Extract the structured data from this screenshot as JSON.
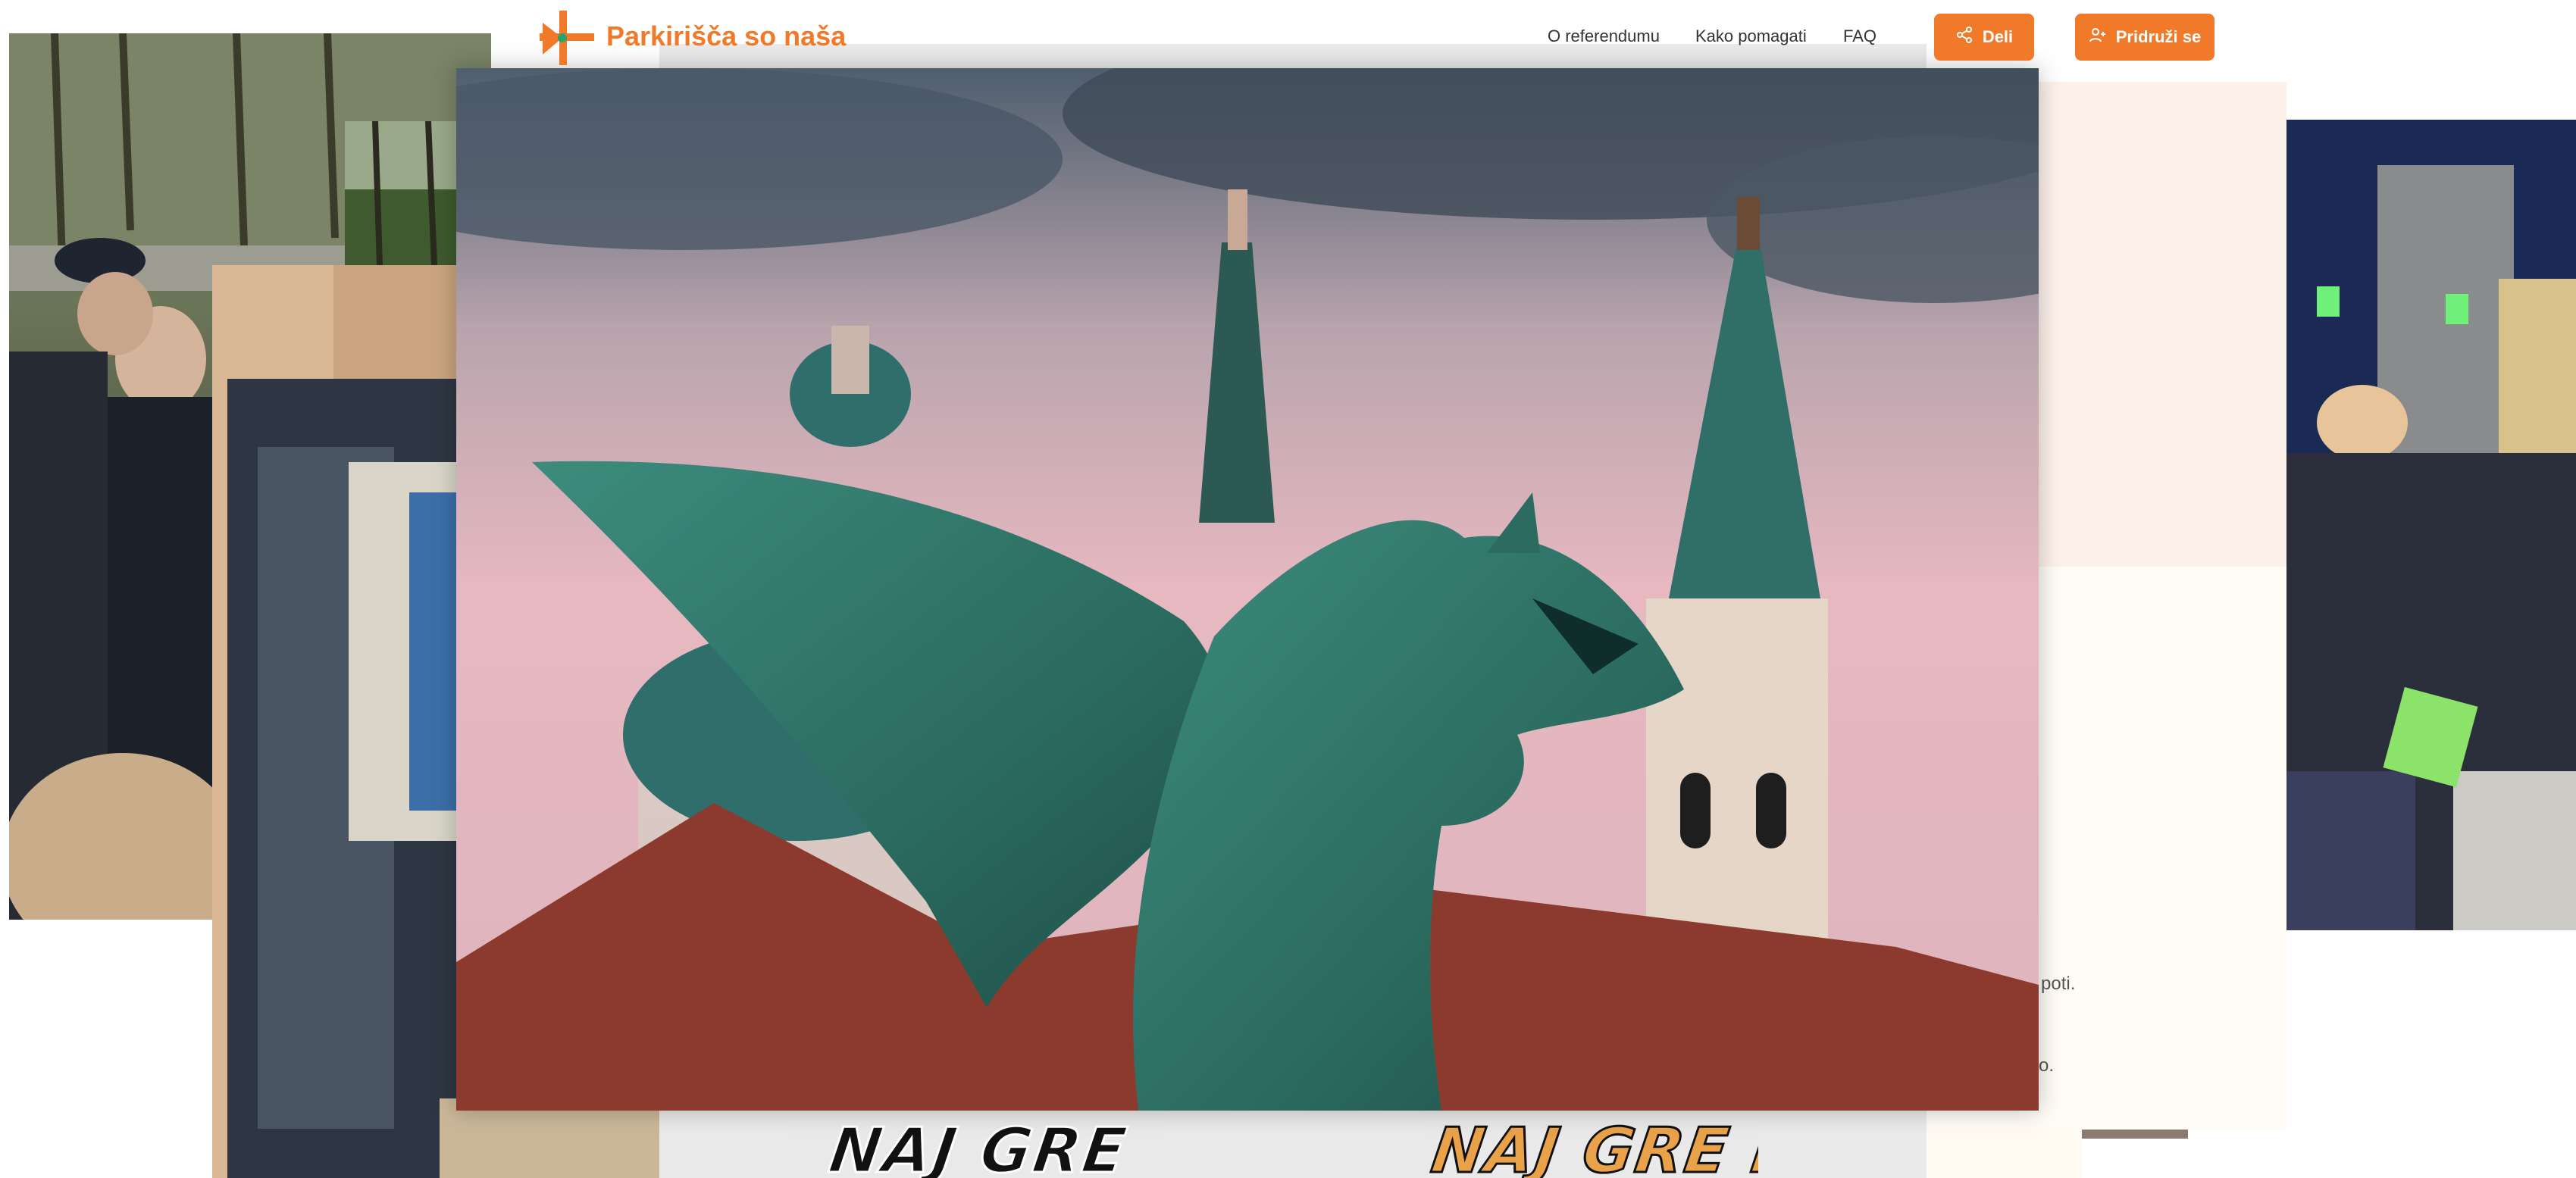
{
  "header": {
    "logo_text": "Parkirišča so naša",
    "nav": [
      {
        "label": "O referendumu"
      },
      {
        "label": "Kako pomagati"
      },
      {
        "label": "FAQ"
      }
    ],
    "share_button": "Deli",
    "join_button": "Pridruži se"
  },
  "fragments": {
    "text1": "poti.",
    "text2": "o."
  },
  "posters": {
    "left": "NAJ GRE",
    "right": "NAJ GRE P"
  },
  "colors": {
    "accent": "#f07a2a",
    "panel_pink": "#fdf1ea",
    "panel_cream": "#fffcf6"
  },
  "icons": {
    "share": "share-icon",
    "join": "user-plus-icon",
    "logo": "parking-logo-icon"
  }
}
